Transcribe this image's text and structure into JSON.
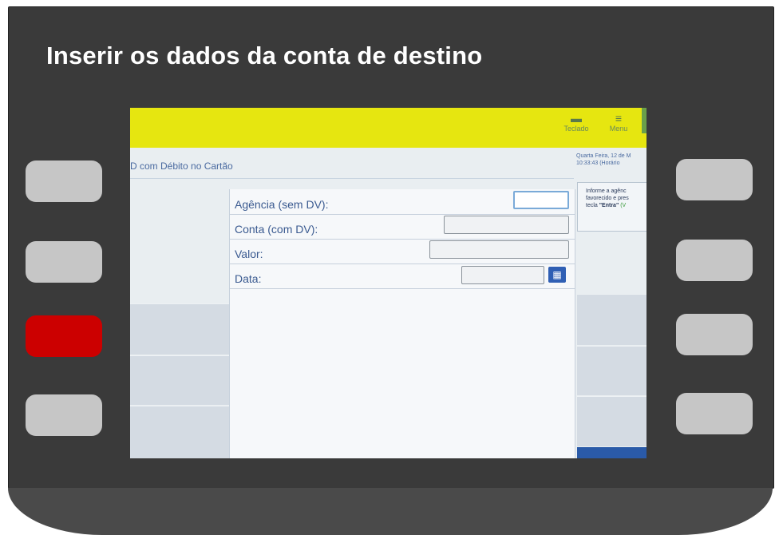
{
  "title": "Inserir os dados da conta de destino",
  "header": {
    "teclado_label": "Teclado",
    "teclado_icon": "keyboard-icon",
    "menu_label": "Menu",
    "menu_icon": "menu-icon"
  },
  "breadcrumb": "D com Débito no Cartão",
  "datetime": "Quarta Feira, 12 de M\n10:33:43 (Horário",
  "info": {
    "line1": "Informe a agênc",
    "line2": "favorecido e pres",
    "line3_prefix": "tecla ",
    "line3_bold": "\"Entra\"",
    "line3_green": " (V"
  },
  "form": {
    "agencia_label": "Agência (sem DV):",
    "conta_label": "Conta (com DV):",
    "valor_label": "Valor:",
    "data_label": "Data:",
    "agencia_value": "",
    "conta_value": "",
    "valor_value": "",
    "data_value": ""
  },
  "colors": {
    "header_yellow": "#e6e610",
    "accent_red": "#cc0000",
    "label_blue": "#3a5a90",
    "calendar_blue": "#2f5fb4"
  },
  "icons": {
    "calendar": "calendar-icon"
  }
}
